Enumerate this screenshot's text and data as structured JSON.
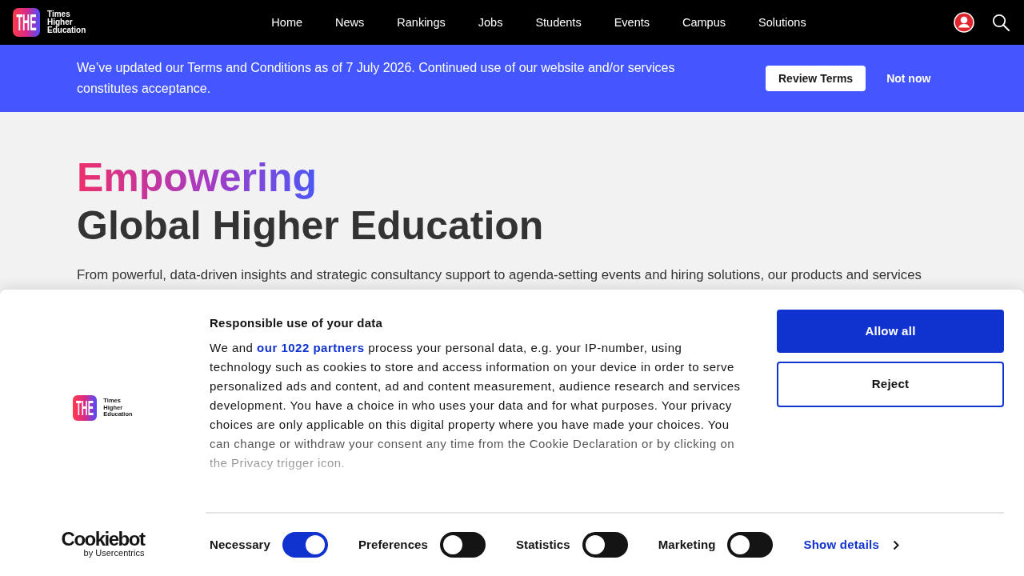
{
  "header": {
    "logo": {
      "mark": "THE",
      "lines": [
        "Times",
        "Higher",
        "Education"
      ]
    },
    "nav": [
      "Home",
      "News",
      "Rankings",
      "Jobs",
      "Students",
      "Events",
      "Campus",
      "Solutions"
    ]
  },
  "notice": {
    "text": "We’ve updated our Terms and Conditions as of 7 July 2026. Continued use of our website and/or services constitutes acceptance.",
    "buttons": [
      {
        "label": "Review Terms",
        "kind": "primary"
      },
      {
        "label": "Not now",
        "kind": "link"
      }
    ]
  },
  "hero": {
    "highlight": "Empowering",
    "title": "Global Higher Education",
    "text": "From powerful, data-driven insights and strategic consultancy support to agenda-setting events and hiring solutions, our products and services"
  },
  "cookie_banner": {
    "logo": {
      "mark": "THE",
      "lines": [
        "Times",
        "Higher",
        "Education"
      ]
    },
    "heading": "Responsible use of your data",
    "text_lead": "We and",
    "partners_link": "our 1022 partners",
    "text": "process your personal data, e.g. your IP-number, using technology such as cookies to store and access information on your device in order to serve personalized ads and content, ad and content measurement, audience research and services development. You have a choice in who uses your data and for what purposes. Your privacy choices are only applicable on this digital property where you have made your choices. You can change or withdraw your consent any time from the Cookie Declaration or by clicking on the Privacy trigger icon.",
    "buttons": [
      {
        "label": "Allow all",
        "kind": "filled"
      },
      {
        "label": "Reject",
        "kind": "outline"
      }
    ],
    "toggles": [
      {
        "label": "Necessary",
        "checked": true
      },
      {
        "label": "Preferences",
        "checked": false
      },
      {
        "label": "Statistics",
        "checked": false
      },
      {
        "label": "Marketing",
        "checked": false
      }
    ],
    "details_link": "Show details",
    "brand": {
      "name": "Cookiebot",
      "byline": "by Usercentrics"
    }
  }
}
